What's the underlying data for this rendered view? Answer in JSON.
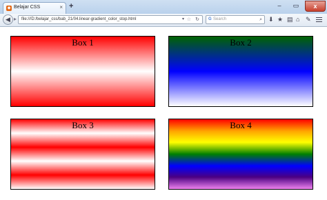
{
  "browser": {
    "tab_title": "Belajar CSS",
    "tab_close": "×",
    "new_tab": "+",
    "window_controls": {
      "minimize": "–",
      "maximize": "▭",
      "close": "x"
    },
    "url": "file:///D:/belajar_css/bab_21/04.linear-gradient_color_stop.html",
    "search_placeholder": "Search",
    "search_engine_letter": "G"
  },
  "page": {
    "boxes": [
      {
        "label": "Box 1",
        "gradient": [
          "#ff0000",
          "#ffffff",
          "#ff0000"
        ]
      },
      {
        "label": "Box 2",
        "gradient": [
          "#006400",
          "#0000ff",
          "#ffffff"
        ]
      },
      {
        "label": "Box 3",
        "gradient": [
          "#ff0000",
          "#ffffff",
          "#ff0000",
          "#ffffff",
          "#ff0000",
          "#ffffff"
        ]
      },
      {
        "label": "Box 4",
        "gradient": [
          "#ff0000",
          "#ffa500",
          "#ffff00",
          "#008000",
          "#0000ff",
          "#4b0082",
          "#ee82ee"
        ]
      }
    ]
  }
}
